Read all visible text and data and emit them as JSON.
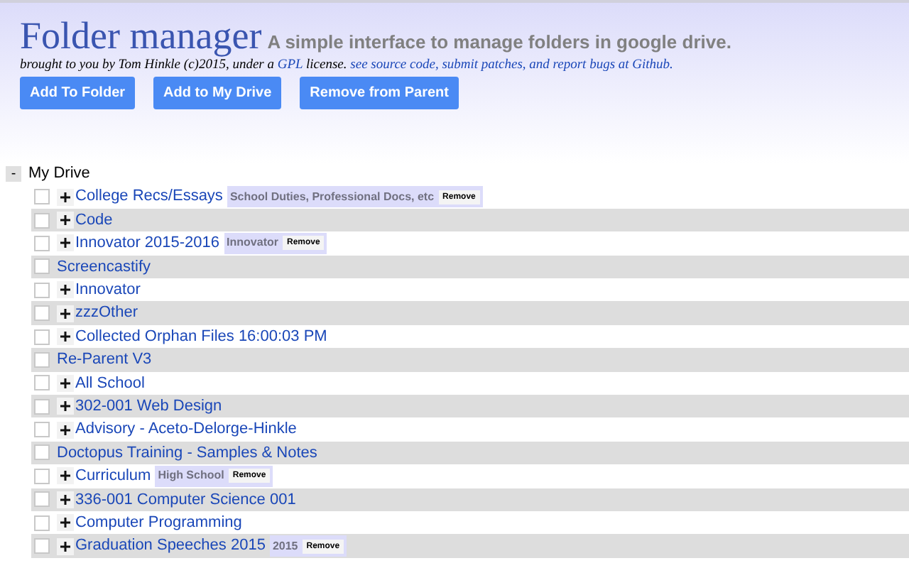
{
  "header": {
    "title": "Folder manager",
    "subtitle": "A simple interface to manage folders in google drive.",
    "byline_prefix": "brought to you by Tom Hinkle (c)2015, under a",
    "gpl_link": "GPL",
    "byline_middle": "license.",
    "source_link": "see source code, submit patches, and report bugs at Github."
  },
  "buttons": [
    "Add To Folder",
    "Add to My Drive",
    "Remove from Parent"
  ],
  "tree": {
    "collapse_toggle": "-",
    "label": "My Drive",
    "expanded": true,
    "children": [
      {
        "name": "College Recs/Essays",
        "expandable": true,
        "checked": false,
        "tags": [
          {
            "label": "School Duties, Professional Docs, etc",
            "remove": "Remove"
          }
        ]
      },
      {
        "name": "Code",
        "expandable": true,
        "checked": false
      },
      {
        "name": "Innovator 2015-2016",
        "expandable": true,
        "checked": false,
        "tags": [
          {
            "label": "Innovator",
            "remove": "Remove"
          }
        ]
      },
      {
        "name": "Screencastify",
        "expandable": false,
        "checked": false
      },
      {
        "name": "Innovator",
        "expandable": true,
        "checked": false
      },
      {
        "name": "zzzOther",
        "expandable": true,
        "checked": false
      },
      {
        "name": "Collected Orphan Files 16:00:03 PM",
        "expandable": true,
        "checked": false
      },
      {
        "name": "Re-Parent V3",
        "expandable": false,
        "checked": false
      },
      {
        "name": "All School",
        "expandable": true,
        "checked": false
      },
      {
        "name": "302-001 Web Design",
        "expandable": true,
        "checked": false
      },
      {
        "name": "Advisory - Aceto-Delorge-Hinkle",
        "expandable": true,
        "checked": false
      },
      {
        "name": "Doctopus Training - Samples & Notes",
        "expandable": false,
        "checked": false
      },
      {
        "name": "Curriculum",
        "expandable": true,
        "checked": false,
        "tags": [
          {
            "label": "High School",
            "remove": "Remove"
          }
        ]
      },
      {
        "name": "336-001 Computer Science 001",
        "expandable": true,
        "checked": false
      },
      {
        "name": "Computer Programming",
        "expandable": true,
        "checked": false
      },
      {
        "name": "Graduation Speeches 2015",
        "expandable": true,
        "checked": false,
        "tags": [
          {
            "label": "2015",
            "remove": "Remove"
          }
        ]
      }
    ]
  }
}
